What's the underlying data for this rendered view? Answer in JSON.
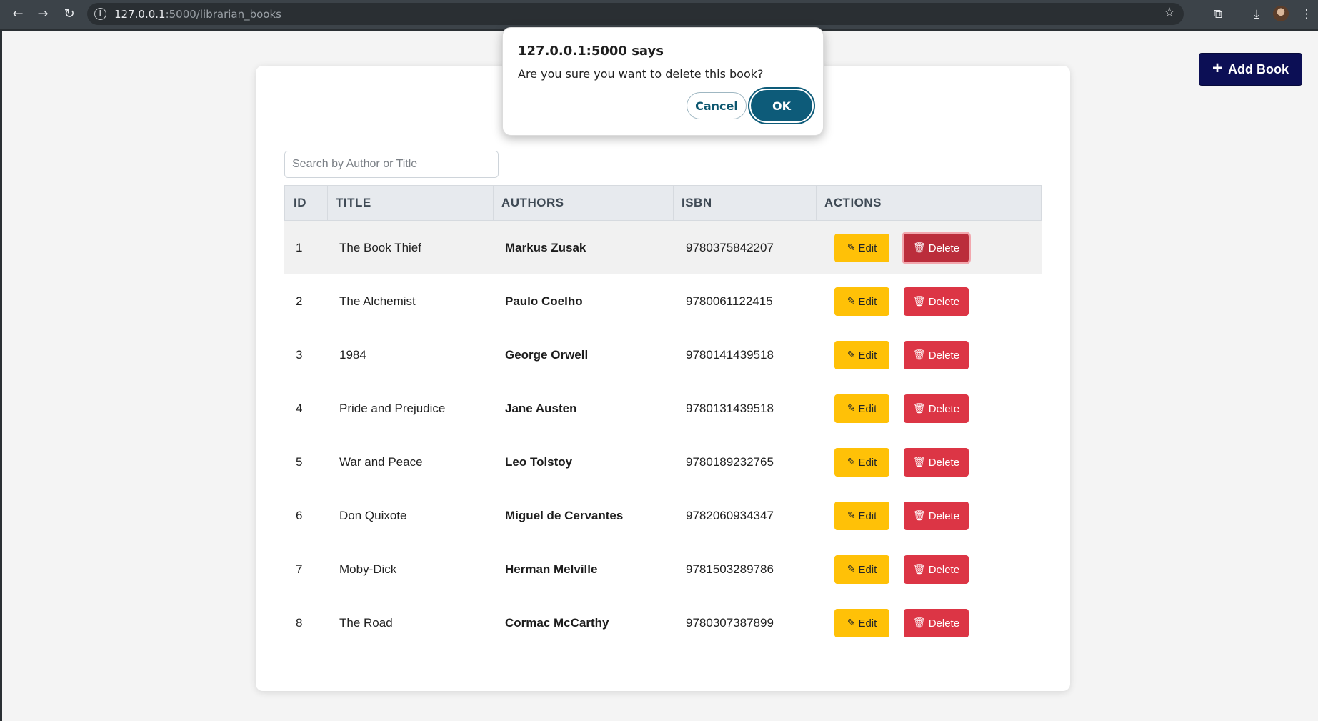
{
  "browser": {
    "url_host": "127.0.0.1",
    "url_rest": ":5000/librarian_books"
  },
  "header": {
    "add_book_label": "Add Book"
  },
  "search": {
    "placeholder": "Search by Author or Title"
  },
  "table": {
    "columns": [
      "ID",
      "TITLE",
      "AUTHORS",
      "ISBN",
      "ACTIONS"
    ],
    "edit_label": "Edit",
    "delete_label": "Delete",
    "rows": [
      {
        "id": "1",
        "title": "The Book Thief",
        "author": "Markus Zusak",
        "isbn": "9780375842207"
      },
      {
        "id": "2",
        "title": "The Alchemist",
        "author": "Paulo Coelho",
        "isbn": "9780061122415"
      },
      {
        "id": "3",
        "title": "1984",
        "author": "George Orwell",
        "isbn": "9780141439518"
      },
      {
        "id": "4",
        "title": "Pride and Prejudice",
        "author": "Jane Austen",
        "isbn": "9780131439518"
      },
      {
        "id": "5",
        "title": "War and Peace",
        "author": "Leo Tolstoy",
        "isbn": "9780189232765"
      },
      {
        "id": "6",
        "title": "Don Quixote",
        "author": "Miguel de Cervantes",
        "isbn": "9782060934347"
      },
      {
        "id": "7",
        "title": "Moby-Dick",
        "author": "Herman Melville",
        "isbn": "9781503289786"
      },
      {
        "id": "8",
        "title": "The Road",
        "author": "Cormac McCarthy",
        "isbn": "9780307387899"
      }
    ]
  },
  "dialog": {
    "title": "127.0.0.1:5000 says",
    "message": "Are you sure you want to delete this book?",
    "cancel_label": "Cancel",
    "ok_label": "OK"
  },
  "colors": {
    "primary_navy": "#0c0f55",
    "edit_yellow": "#ffc107",
    "delete_red": "#dc3545",
    "dialog_accent": "#0d5b79"
  }
}
